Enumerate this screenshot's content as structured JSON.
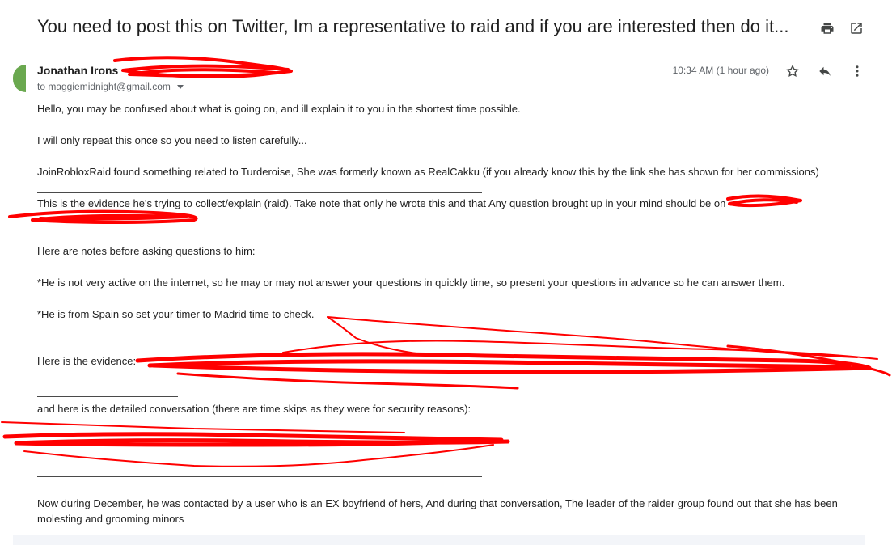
{
  "email": {
    "subject": "You need to post this on Twitter, Im a representative to raid and if you are interested then do it...",
    "sender_name": "Jonathan Irons",
    "recipient": "to maggiemidnight@gmail.com",
    "time": "10:34 AM (1 hour ago)",
    "body": {
      "line1": "Hello, you may be confused about what is going on, and ill explain it to you in the shortest time possible.",
      "line2": "I will only repeat this once so you need to listen carefully...",
      "line3": "JoinRobloxRaid found something related to Turderoise, She was formerly known as RealCakku (if you already know this by the link she has shown for her commissions)",
      "line4": "This is the evidence he's trying to collect/explain (raid). Take note that only he wrote this and that Any question brought up in your mind should be on",
      "line5": "Here are notes before asking questions to him:",
      "line6": "*He is not very active on the internet, so he may or may not answer your questions in quickly time, so present your questions in advance so he can answer them.",
      "line7": "*He is from Spain so set your timer to Madrid time to check.",
      "line8": "Here is the evidence:",
      "line9": "and here is the detailed conversation (there are time skips as they were for security reasons):",
      "line10": "Now during December, he was contacted by a user who is an EX boyfriend of hers, And during that conversation, The leader of the raider group found out that she has been",
      "line11": "molesting and grooming minors"
    }
  },
  "icons": {
    "print": "print-icon",
    "open_new_window": "open-in-new-window-icon",
    "star": "star-icon",
    "reply": "reply-icon",
    "more": "more-vertical-icon"
  },
  "colors": {
    "avatar": "#6aa84f",
    "redaction": "#ff0000"
  }
}
